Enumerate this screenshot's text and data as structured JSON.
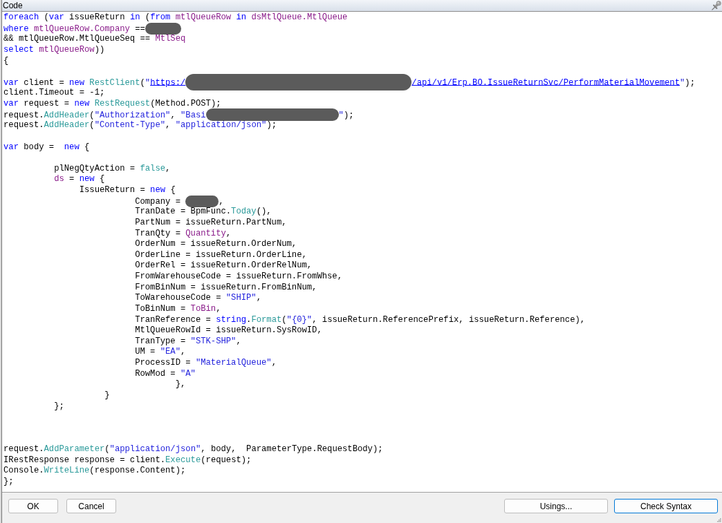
{
  "window": {
    "title": "Code"
  },
  "code": {
    "lines": [
      {
        "kind": "code",
        "tokens": [
          {
            "kind": "keyword",
            "text": "foreach"
          },
          {
            "kind": "plain",
            "text": " ("
          },
          {
            "kind": "keyword",
            "text": "var"
          },
          {
            "kind": "plain",
            "text": " issueReturn "
          },
          {
            "kind": "keyword",
            "text": "in"
          },
          {
            "kind": "plain",
            "text": " ("
          },
          {
            "kind": "keyword",
            "text": "from"
          },
          {
            "kind": "member",
            "text": " mtlQueueRow "
          },
          {
            "kind": "keyword",
            "text": "in"
          },
          {
            "kind": "member",
            "text": " dsMtlQueue.MtlQueue"
          }
        ]
      },
      {
        "kind": "code",
        "tokens": [
          {
            "kind": "keyword",
            "text": "where"
          },
          {
            "kind": "member",
            "text": " mtlQueueRow.Company"
          },
          {
            "kind": "plain",
            "text": " =="
          },
          {
            "kind": "redacted"
          }
        ]
      },
      {
        "kind": "code",
        "tokens": [
          {
            "kind": "plain",
            "text": "&& mtlQueueRow.MtlQueueSeq == "
          },
          {
            "kind": "member",
            "text": "MtlSeq"
          }
        ]
      },
      {
        "kind": "code",
        "tokens": [
          {
            "kind": "keyword",
            "text": "select"
          },
          {
            "kind": "member",
            "text": " mtlQueueRow"
          },
          {
            "kind": "plain",
            "text": "))"
          }
        ]
      },
      {
        "kind": "code",
        "tokens": [
          {
            "kind": "plain",
            "text": "{"
          }
        ]
      },
      {
        "kind": "blank"
      },
      {
        "kind": "code",
        "tokens": [
          {
            "kind": "keyword",
            "text": "var"
          },
          {
            "kind": "plain",
            "text": " client = "
          },
          {
            "kind": "keyword",
            "text": "new"
          },
          {
            "kind": "type",
            "text": " RestClient"
          },
          {
            "kind": "plain",
            "text": "("
          },
          {
            "kind": "string",
            "text": "\""
          },
          {
            "kind": "link",
            "text": "https:/"
          },
          {
            "kind": "redacted"
          },
          {
            "kind": "link",
            "text": "/api/v1/Erp.BO.IssueReturnSvc/PerformMaterialMovement"
          },
          {
            "kind": "string",
            "text": "\""
          },
          {
            "kind": "plain",
            "text": ");"
          }
        ]
      },
      {
        "kind": "code",
        "tokens": [
          {
            "kind": "plain",
            "text": "client.Timeout = -1;"
          }
        ]
      },
      {
        "kind": "code",
        "tokens": [
          {
            "kind": "keyword",
            "text": "var"
          },
          {
            "kind": "plain",
            "text": " request = "
          },
          {
            "kind": "keyword",
            "text": "new"
          },
          {
            "kind": "type",
            "text": " RestRequest"
          },
          {
            "kind": "plain",
            "text": "(Method.POST);"
          }
        ]
      },
      {
        "kind": "code",
        "tokens": [
          {
            "kind": "plain",
            "text": "request."
          },
          {
            "kind": "type",
            "text": "AddHeader"
          },
          {
            "kind": "plain",
            "text": "("
          },
          {
            "kind": "string",
            "text": "\"Authorization\""
          },
          {
            "kind": "plain",
            "text": ", "
          },
          {
            "kind": "string",
            "text": "\"Basi"
          },
          {
            "kind": "redacted"
          },
          {
            "kind": "string",
            "text": "\""
          },
          {
            "kind": "plain",
            "text": ");"
          }
        ]
      },
      {
        "kind": "code",
        "tokens": [
          {
            "kind": "plain",
            "text": "request."
          },
          {
            "kind": "type",
            "text": "AddHeader"
          },
          {
            "kind": "plain",
            "text": "("
          },
          {
            "kind": "string",
            "text": "\"Content-Type\""
          },
          {
            "kind": "plain",
            "text": ", "
          },
          {
            "kind": "string",
            "text": "\"application/json\""
          },
          {
            "kind": "plain",
            "text": ");"
          }
        ]
      },
      {
        "kind": "blank"
      },
      {
        "kind": "code",
        "tokens": [
          {
            "kind": "keyword",
            "text": "var"
          },
          {
            "kind": "plain",
            "text": " body =  "
          },
          {
            "kind": "keyword",
            "text": "new"
          },
          {
            "kind": "plain",
            "text": " {"
          }
        ]
      },
      {
        "kind": "blank"
      },
      {
        "kind": "code",
        "tokens": [
          {
            "kind": "plain",
            "text": "          plNegQtyAction = "
          },
          {
            "kind": "type",
            "text": "false"
          },
          {
            "kind": "plain",
            "text": ","
          }
        ]
      },
      {
        "kind": "code",
        "tokens": [
          {
            "kind": "member",
            "text": "          ds"
          },
          {
            "kind": "plain",
            "text": " = "
          },
          {
            "kind": "keyword",
            "text": "new"
          },
          {
            "kind": "plain",
            "text": " {"
          }
        ]
      },
      {
        "kind": "code",
        "tokens": [
          {
            "kind": "plain",
            "text": "               IssueReturn = "
          },
          {
            "kind": "keyword",
            "text": "new"
          },
          {
            "kind": "plain",
            "text": " {"
          }
        ]
      },
      {
        "kind": "code",
        "tokens": [
          {
            "kind": "plain",
            "text": "                          Company = "
          },
          {
            "kind": "redacted"
          },
          {
            "kind": "plain",
            "text": ","
          }
        ]
      },
      {
        "kind": "code",
        "tokens": [
          {
            "kind": "plain",
            "text": "                          TranDate = BpmFunc."
          },
          {
            "kind": "type",
            "text": "Today"
          },
          {
            "kind": "plain",
            "text": "(),"
          }
        ]
      },
      {
        "kind": "code",
        "tokens": [
          {
            "kind": "plain",
            "text": "                          PartNum = issueReturn.PartNum,"
          }
        ]
      },
      {
        "kind": "code",
        "tokens": [
          {
            "kind": "plain",
            "text": "                          TranQty = "
          },
          {
            "kind": "member",
            "text": "Quantity"
          },
          {
            "kind": "plain",
            "text": ","
          }
        ]
      },
      {
        "kind": "code",
        "tokens": [
          {
            "kind": "plain",
            "text": "                          OrderNum = issueReturn.OrderNum,"
          }
        ]
      },
      {
        "kind": "code",
        "tokens": [
          {
            "kind": "plain",
            "text": "                          OrderLine = issueReturn.OrderLine,"
          }
        ]
      },
      {
        "kind": "code",
        "tokens": [
          {
            "kind": "plain",
            "text": "                          OrderRel = issueReturn.OrderRelNum,"
          }
        ]
      },
      {
        "kind": "code",
        "tokens": [
          {
            "kind": "plain",
            "text": "                          FromWarehouseCode = issueReturn.FromWhse,"
          }
        ]
      },
      {
        "kind": "code",
        "tokens": [
          {
            "kind": "plain",
            "text": "                          FromBinNum = issueReturn.FromBinNum,"
          }
        ]
      },
      {
        "kind": "code",
        "tokens": [
          {
            "kind": "plain",
            "text": "                          ToWarehouseCode = "
          },
          {
            "kind": "string",
            "text": "\"SHIP\""
          },
          {
            "kind": "plain",
            "text": ","
          }
        ]
      },
      {
        "kind": "code",
        "tokens": [
          {
            "kind": "plain",
            "text": "                          ToBinNum = "
          },
          {
            "kind": "member",
            "text": "ToBin"
          },
          {
            "kind": "plain",
            "text": ","
          }
        ]
      },
      {
        "kind": "code",
        "tokens": [
          {
            "kind": "plain",
            "text": "                          TranReference = "
          },
          {
            "kind": "keyword",
            "text": "string"
          },
          {
            "kind": "plain",
            "text": "."
          },
          {
            "kind": "type",
            "text": "Format"
          },
          {
            "kind": "plain",
            "text": "("
          },
          {
            "kind": "string",
            "text": "\"{0}\""
          },
          {
            "kind": "plain",
            "text": ", issueReturn.ReferencePrefix, issueReturn.Reference),"
          }
        ]
      },
      {
        "kind": "code",
        "tokens": [
          {
            "kind": "plain",
            "text": "                          MtlQueueRowId = issueReturn.SysRowID,"
          }
        ]
      },
      {
        "kind": "code",
        "tokens": [
          {
            "kind": "plain",
            "text": "                          TranType = "
          },
          {
            "kind": "string",
            "text": "\"STK-SHP\""
          },
          {
            "kind": "plain",
            "text": ","
          }
        ]
      },
      {
        "kind": "code",
        "tokens": [
          {
            "kind": "plain",
            "text": "                          UM = "
          },
          {
            "kind": "string",
            "text": "\"EA\""
          },
          {
            "kind": "plain",
            "text": ","
          }
        ]
      },
      {
        "kind": "code",
        "tokens": [
          {
            "kind": "plain",
            "text": "                          ProcessID = "
          },
          {
            "kind": "string",
            "text": "\"MaterialQueue\""
          },
          {
            "kind": "plain",
            "text": ","
          }
        ]
      },
      {
        "kind": "code",
        "tokens": [
          {
            "kind": "plain",
            "text": "                          RowMod = "
          },
          {
            "kind": "string",
            "text": "\"A\""
          }
        ]
      },
      {
        "kind": "code",
        "tokens": [
          {
            "kind": "plain",
            "text": "                                  },"
          }
        ]
      },
      {
        "kind": "code",
        "tokens": [
          {
            "kind": "plain",
            "text": "                    }"
          }
        ]
      },
      {
        "kind": "code",
        "tokens": [
          {
            "kind": "plain",
            "text": "          };"
          }
        ]
      },
      {
        "kind": "blank"
      },
      {
        "kind": "blank"
      },
      {
        "kind": "blank"
      },
      {
        "kind": "code",
        "tokens": [
          {
            "kind": "plain",
            "text": "request."
          },
          {
            "kind": "type",
            "text": "AddParameter"
          },
          {
            "kind": "plain",
            "text": "("
          },
          {
            "kind": "string",
            "text": "\"application/json\""
          },
          {
            "kind": "plain",
            "text": ", body,  ParameterType.RequestBody);"
          }
        ]
      },
      {
        "kind": "code",
        "tokens": [
          {
            "kind": "plain",
            "text": "IRestResponse response = client."
          },
          {
            "kind": "type",
            "text": "Execute"
          },
          {
            "kind": "plain",
            "text": "(request);"
          }
        ]
      },
      {
        "kind": "code",
        "tokens": [
          {
            "kind": "plain",
            "text": "Console."
          },
          {
            "kind": "type",
            "text": "WriteLine"
          },
          {
            "kind": "plain",
            "text": "(response.Content);"
          }
        ]
      },
      {
        "kind": "code",
        "tokens": [
          {
            "kind": "plain",
            "text": "};"
          }
        ]
      }
    ]
  },
  "footer": {
    "left_buttons": [
      {
        "label": "OK",
        "focused": false
      },
      {
        "label": "Cancel",
        "focused": false
      }
    ],
    "right_buttons": [
      {
        "label": "Usings...",
        "focused": false
      },
      {
        "label": "Check Syntax",
        "focused": true
      }
    ]
  }
}
